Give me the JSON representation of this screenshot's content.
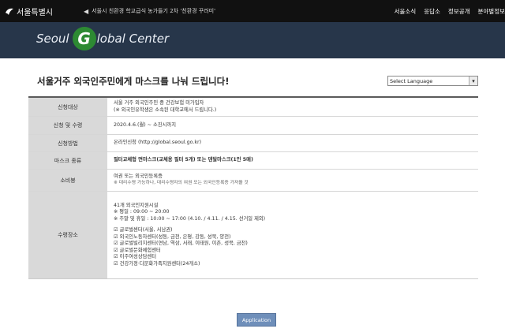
{
  "topbar": {
    "logo_text": "서울특별시",
    "ticker": "서울시 친환경 학교급식 농가들기 2차 '친환경 꾸러미'",
    "nav": [
      "서울소식",
      "응답소",
      "정보공개",
      "분야별정보"
    ]
  },
  "banner": {
    "brand_left": "Seoul",
    "brand_g": "G",
    "brand_right": "lobal Center"
  },
  "page": {
    "title": "서울거주 외국인주민에게 마스크를 나눠 드립니다!",
    "language_select": "Select Language"
  },
  "form": {
    "rows": [
      {
        "label": "신청대상",
        "lines": [
          "서울 거주 외국인주민 중 건강보험 미가입자",
          "(※ 외국인유학생은 소속된 대학교에서 드립니다.)"
        ]
      },
      {
        "label": "신청 및 수령",
        "lines": [
          "2020.4.6.(월) ~ 소진시까지"
        ]
      },
      {
        "label": "신청방법",
        "lines": [
          "온라인신청 (http://global.seoul.go.kr)"
        ]
      },
      {
        "label": "마스크 종류",
        "lines": [
          "필터교체형 면마스크(교체용 필터 5개) 또는 덴탈마스크(1인 5매)"
        ]
      },
      {
        "label": "소비봉",
        "lines": [
          "여권 또는 외국인등록증",
          "※ 대리수령 가능하나, 대리수령자의 여권 또는 외국인등록증 가져올 것"
        ]
      },
      {
        "label": "수령장소",
        "lines": [
          "41개 외국인지원시설",
          "※ 평일 : 09:00 ~ 20:00",
          "※ 주말 및 휴일 : 10:00 ~ 17:00 (4.10. / 4.11. / 4.15. 선거일 제외)",
          "",
          "☑ 글로벌센터(서울, 서남권)",
          "☑ 외국인노동자센터(성동, 금천, 은평, 강동, 성북, 양천)",
          "☑ 글로벌빌리지센터(연남, 역삼, 서래, 이태원, 이촌, 성북, 금천)",
          "☑ 글로벌문화체험센터",
          "☑ 이주여성상담센터",
          "☑ 건강가정·다문화가족지원센터(24개소)"
        ]
      }
    ]
  },
  "button": {
    "label": "Application"
  },
  "colors": {
    "topbar": "#111111",
    "banner": "#27364a",
    "label_bg": "#d9d9d9",
    "button": "#6f8fba",
    "logo_g": "#2d8a33"
  }
}
